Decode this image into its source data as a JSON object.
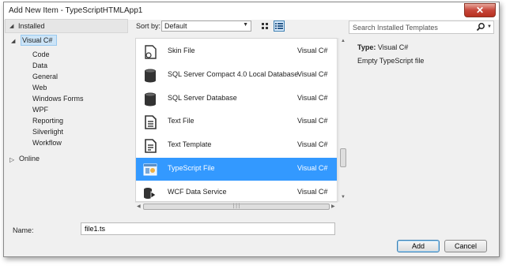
{
  "window": {
    "title": "Add New Item - TypeScriptHTMLApp1",
    "close_label": "✕"
  },
  "left_pane": {
    "installed_label": "Installed",
    "tree": {
      "root": "Visual C#",
      "children": [
        "Code",
        "Data",
        "General",
        "Web",
        "Windows Forms",
        "WPF",
        "Reporting",
        "Silverlight",
        "Workflow"
      ],
      "online": "Online"
    }
  },
  "sort_bar": {
    "label": "Sort by:",
    "selected": "Default"
  },
  "search": {
    "placeholder": "Search Installed Templates"
  },
  "templates": [
    {
      "name": "Skin File",
      "lang": "Visual C#",
      "icon": "skin-file-icon",
      "selected": false
    },
    {
      "name": "SQL Server Compact 4.0 Local Database",
      "lang": "Visual C#",
      "icon": "database-icon",
      "selected": false
    },
    {
      "name": "SQL Server Database",
      "lang": "Visual C#",
      "icon": "database-icon",
      "selected": false
    },
    {
      "name": "Text File",
      "lang": "Visual C#",
      "icon": "text-file-icon",
      "selected": false
    },
    {
      "name": "Text Template",
      "lang": "Visual C#",
      "icon": "text-template-icon",
      "selected": false
    },
    {
      "name": "TypeScript File",
      "lang": "Visual C#",
      "icon": "typescript-file-icon",
      "selected": true
    },
    {
      "name": "WCF Data Service",
      "lang": "Visual C#",
      "icon": "wcf-service-icon",
      "selected": false
    }
  ],
  "details": {
    "type_label": "Type:",
    "type_value": "Visual C#",
    "description": "Empty TypeScript file"
  },
  "name_field": {
    "label": "Name:",
    "value": "file1.ts"
  },
  "buttons": {
    "add": "Add",
    "cancel": "Cancel"
  },
  "colors": {
    "selection": "#3399ff",
    "tree_selection": "#cce4f7"
  }
}
